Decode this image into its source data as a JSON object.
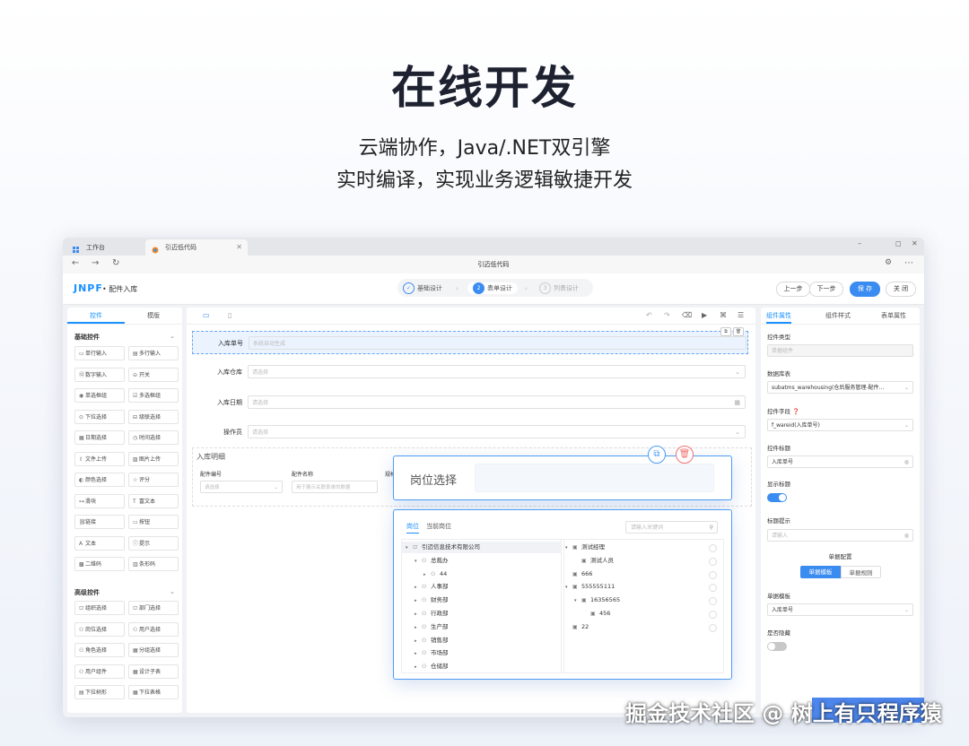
{
  "hero": {
    "title": "在线开发",
    "subtitle_1": "云端协作，Java/.NET双引擎",
    "subtitle_2": "实时编译，实现业务逻辑敏捷开发"
  },
  "browser": {
    "tabs": [
      {
        "label": "工作台"
      },
      {
        "label": "引迈低代码"
      }
    ],
    "address_title": "引迈低代码"
  },
  "app": {
    "logo": "JNPF",
    "page_title": "• 配件入库",
    "steps": [
      {
        "num": "1",
        "label": "基础设计"
      },
      {
        "num": "2",
        "label": "表单设计"
      },
      {
        "num": "3",
        "label": "列表设计"
      }
    ],
    "buttons": {
      "prev": "上一步",
      "next": "下一步",
      "save": "保 存",
      "close": "关 闭"
    }
  },
  "left_panel": {
    "tabs": [
      "控件",
      "模版"
    ],
    "basic_group": "基础控件",
    "basic_items": [
      "单行输入",
      "多行输入",
      "数字输入",
      "开关",
      "单选框组",
      "多选框组",
      "下拉选择",
      "级联选择",
      "日期选择",
      "时间选择",
      "文件上传",
      "图片上传",
      "颜色选择",
      "评分",
      "滑块",
      "富文本",
      "链接",
      "按钮",
      "文本",
      "提示",
      "二维码",
      "条形码"
    ],
    "advanced_group": "高级控件",
    "advanced_items": [
      "组织选择",
      "部门选择",
      "岗位选择",
      "用户选择",
      "角色选择",
      "分组选择",
      "用户组件",
      "设计子表",
      "下拉树形",
      "下拉表格"
    ]
  },
  "canvas": {
    "fields": [
      {
        "label": "入库单号",
        "placeholder": "系统自动生成"
      },
      {
        "label": "入库仓库",
        "placeholder": "请选择"
      },
      {
        "label": "入库日期",
        "placeholder": "请选择"
      },
      {
        "label": "操作员",
        "placeholder": "请选择"
      }
    ],
    "subtable": {
      "title": "入库明细",
      "columns": [
        {
          "label": "配件编号",
          "placeholder": "请选择"
        },
        {
          "label": "配件名称",
          "placeholder": "用于展示关联表单的数据"
        },
        {
          "label": "规格",
          "placeholder": ""
        }
      ]
    }
  },
  "right_panel": {
    "tabs": [
      "组件属性",
      "组件样式",
      "表单属性"
    ],
    "control_type_label": "控件类型",
    "control_type_value": "单据组件",
    "data_table_label": "数据库表",
    "data_table_value": "subatms_warehousing(仓后服务管理-配件...",
    "field_label": "控件字段",
    "field_value": "f_wareid(入库单号)",
    "title_label": "控件标题",
    "title_value": "入库单号",
    "show_title_label": "显示标题",
    "placeholder_label": "标题提示",
    "placeholder_value": "请输入",
    "config_title": "单据配置",
    "seg": [
      "单据模板",
      "单据规则"
    ],
    "template_label": "单据模板",
    "template_value": "入库单号",
    "hidden_label": "是否隐藏"
  },
  "popup_field": {
    "label": "岗位选择"
  },
  "popup_tree": {
    "tabs": [
      "岗位",
      "当前岗位"
    ],
    "search_placeholder": "请输入关键词",
    "left_nodes": [
      {
        "label": "引迈信息技术有限公司"
      },
      {
        "label": "总裁办"
      },
      {
        "label": "44"
      },
      {
        "label": "人事部"
      },
      {
        "label": "财务部"
      },
      {
        "label": "行政部"
      },
      {
        "label": "生产部"
      },
      {
        "label": "销售部"
      },
      {
        "label": "市场部"
      },
      {
        "label": "仓储部"
      }
    ],
    "right_nodes": [
      {
        "label": "测试经理"
      },
      {
        "label": "测试人员"
      },
      {
        "label": "666"
      },
      {
        "label": "555555111"
      },
      {
        "label": "16356565"
      },
      {
        "label": "456"
      },
      {
        "label": "22"
      }
    ]
  },
  "watermark": "掘金技术社区 @ 树上有只程序猿"
}
